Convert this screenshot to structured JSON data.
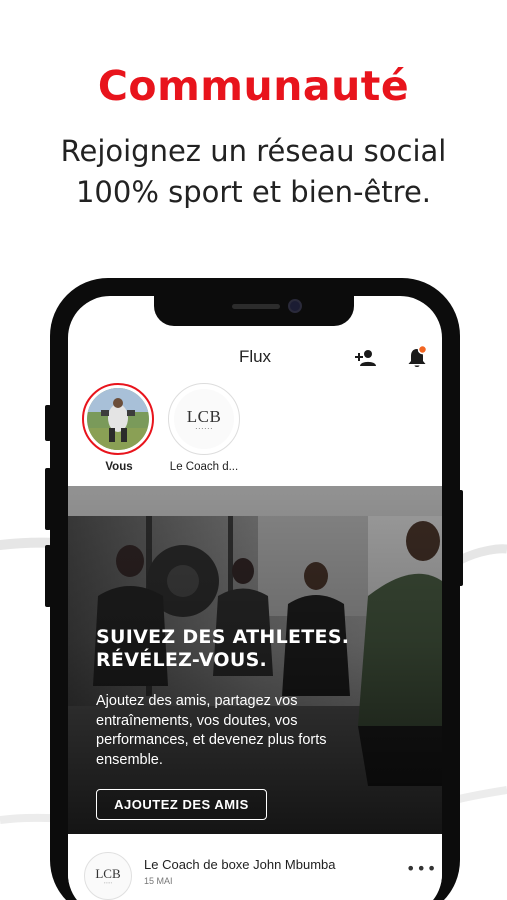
{
  "hero": {
    "title": "Communauté",
    "subtitle_line1": "Rejoignez un réseau social",
    "subtitle_line2": "100% sport et bien-être."
  },
  "app": {
    "header_title": "Flux",
    "icons": {
      "add_friend": "add-user-icon",
      "notifications": "bell-icon"
    },
    "stories": [
      {
        "name": "Vous"
      },
      {
        "name": "Le Coach d..."
      }
    ],
    "banner": {
      "title_line1": "SUIVEZ DES ATHLETES.",
      "title_line2": "RÉVÉLEZ-VOUS.",
      "text_line1": "Ajoutez des amis, partagez vos",
      "text_line2": "entraînements, vos doutes, vos",
      "text_line3": "performances, et devenez plus forts",
      "text_line4": "ensemble.",
      "cta_label": "AJOUTEZ DES AMIS"
    },
    "post": {
      "author": "Le Coach de boxe John Mbumba",
      "date": "15 MAI",
      "more_label": "•••"
    },
    "logo_text": "LCB"
  },
  "colors": {
    "accent": "#e8141c",
    "notification_dot": "#f26522",
    "phone_frame": "#0c0c0c"
  }
}
